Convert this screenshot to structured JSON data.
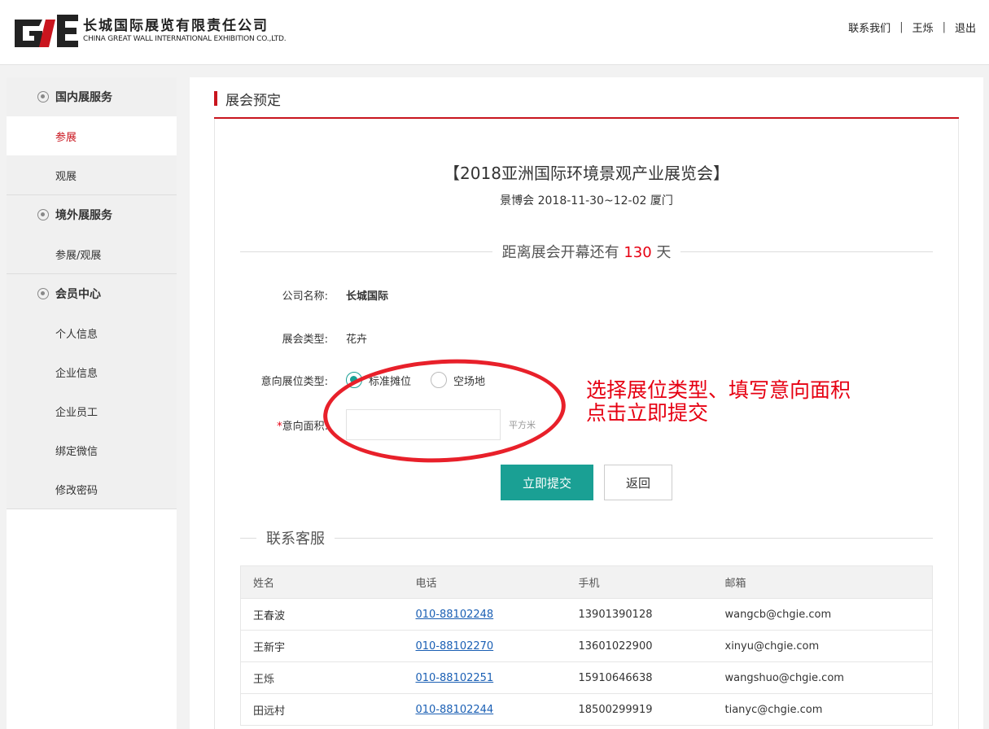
{
  "header": {
    "logo_cn": "长城国际展览有限责任公司",
    "logo_en": "CHINA GREAT WALL INTERNATIONAL EXHIBITION CO.,LTD.",
    "links": [
      "联系我们",
      "王烁",
      "退出"
    ],
    "separator": "|"
  },
  "sidebar": {
    "groups": [
      {
        "title": "国内展服务",
        "items": [
          {
            "label": "参展",
            "active": true
          },
          {
            "label": "观展",
            "active": false
          }
        ]
      },
      {
        "title": "境外展服务",
        "items": [
          {
            "label": "参展/观展",
            "active": false
          }
        ]
      },
      {
        "title": "会员中心",
        "items": [
          {
            "label": "个人信息"
          },
          {
            "label": "企业信息"
          },
          {
            "label": "企业员工"
          },
          {
            "label": "绑定微信"
          },
          {
            "label": "修改密码"
          }
        ]
      }
    ]
  },
  "main": {
    "panel_title": "展会预定",
    "expo_title": "【2018亚洲国际环境景观产业展览会】",
    "expo_sub": "景博会 2018-11-30~12-02 厦门",
    "countdown": {
      "prefix": "距离展会开幕还有",
      "days": "130",
      "suffix": "天"
    },
    "form": {
      "company_label": "公司名称:",
      "company_value": "长城国际",
      "type_label": "展会类型:",
      "type_value": "花卉",
      "booth_label": "意向展位类型:",
      "booth_options": [
        {
          "label": "标准摊位",
          "checked": true
        },
        {
          "label": "空场地",
          "checked": false
        }
      ],
      "area_required": "*",
      "area_label": "意向面积:",
      "area_value": "",
      "area_unit": "平方米"
    },
    "buttons": {
      "submit": "立即提交",
      "back": "返回"
    },
    "annotation": {
      "line1": "选择展位类型、填写意向面积",
      "line2": "点击立即提交"
    },
    "contacts": {
      "title": "联系客服",
      "columns": [
        "姓名",
        "电话",
        "手机",
        "邮箱"
      ],
      "rows": [
        {
          "name": "王春波",
          "phone": "010-88102248",
          "mobile": "13901390128",
          "email": "wangcb@chgie.com"
        },
        {
          "name": "王新宇",
          "phone": "010-88102270",
          "mobile": "13601022900",
          "email": "xinyu@chgie.com"
        },
        {
          "name": "王烁",
          "phone": "010-88102251",
          "mobile": "15910646638",
          "email": "wangshuo@chgie.com"
        },
        {
          "name": "田远村",
          "phone": "010-88102244",
          "mobile": "18500299919",
          "email": "tianyc@chgie.com"
        }
      ]
    }
  },
  "colors": {
    "brand_red": "#c9151e",
    "accent_teal": "#1aa094",
    "annotation_red": "#e60012"
  }
}
